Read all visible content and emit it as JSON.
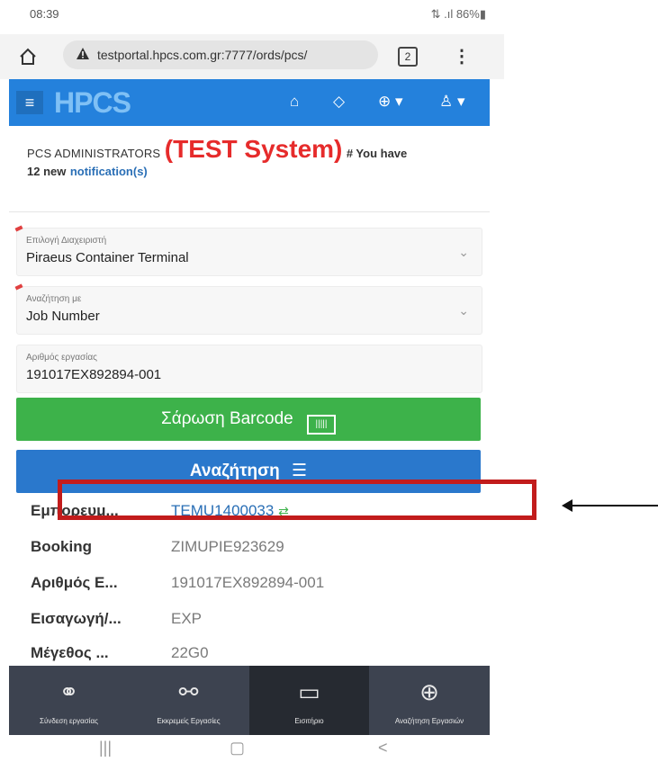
{
  "status_bar": {
    "time": "08:39",
    "signal_battery": "⇅ .ıl 86%▮"
  },
  "browser": {
    "url": "testportal.hpcs.com.gr:7777/ords/pcs/",
    "tab_count": "2"
  },
  "navbar": {
    "logo": "HPCS",
    "color": "#2481dc"
  },
  "header": {
    "org": "PCS ADMINISTRATORS",
    "test_label": "(TEST System)",
    "notif_prefix": "# You have",
    "notif_count_text": "12 new",
    "notif_link": "notification(s)"
  },
  "form": {
    "operator": {
      "label": "Επιλογή Διαχειριστή",
      "value": "Piraeus Container Terminal"
    },
    "search_by": {
      "label": "Αναζήτηση με",
      "value": "Job Number"
    },
    "job_number": {
      "label": "Αριθμός εργασίας",
      "value": "191017EX892894-001"
    }
  },
  "buttons": {
    "scan_barcode": "Σάρωση Barcode",
    "search": "Αναζήτηση"
  },
  "results": [
    {
      "key": "Εμπορευμ...",
      "value": "TEMU1400033"
    },
    {
      "key": "Booking",
      "value": "ZIMUPIE923629"
    },
    {
      "key": "Αριθμός Ε...",
      "value": "191017EX892894-001"
    },
    {
      "key": "Εισαγωγή/...",
      "value": "EXP"
    },
    {
      "key": "Μέγεθος ...",
      "value": "22G0"
    }
  ],
  "bottom_nav": [
    {
      "label": "Σύνδεση εργασίας",
      "icon": "link-icon"
    },
    {
      "label": "Εκκρεμείς Εργασίες",
      "icon": "unlink-icon"
    },
    {
      "label": "Εισιτήριο",
      "icon": "ticket-icon"
    },
    {
      "label": "Αναζήτηση Εργασιών",
      "icon": "zoom-icon"
    }
  ],
  "colors": {
    "green": "#3db24a",
    "blue": "#2a78cc",
    "red_highlight": "#c21c1c",
    "test_red": "#e62b2b"
  }
}
